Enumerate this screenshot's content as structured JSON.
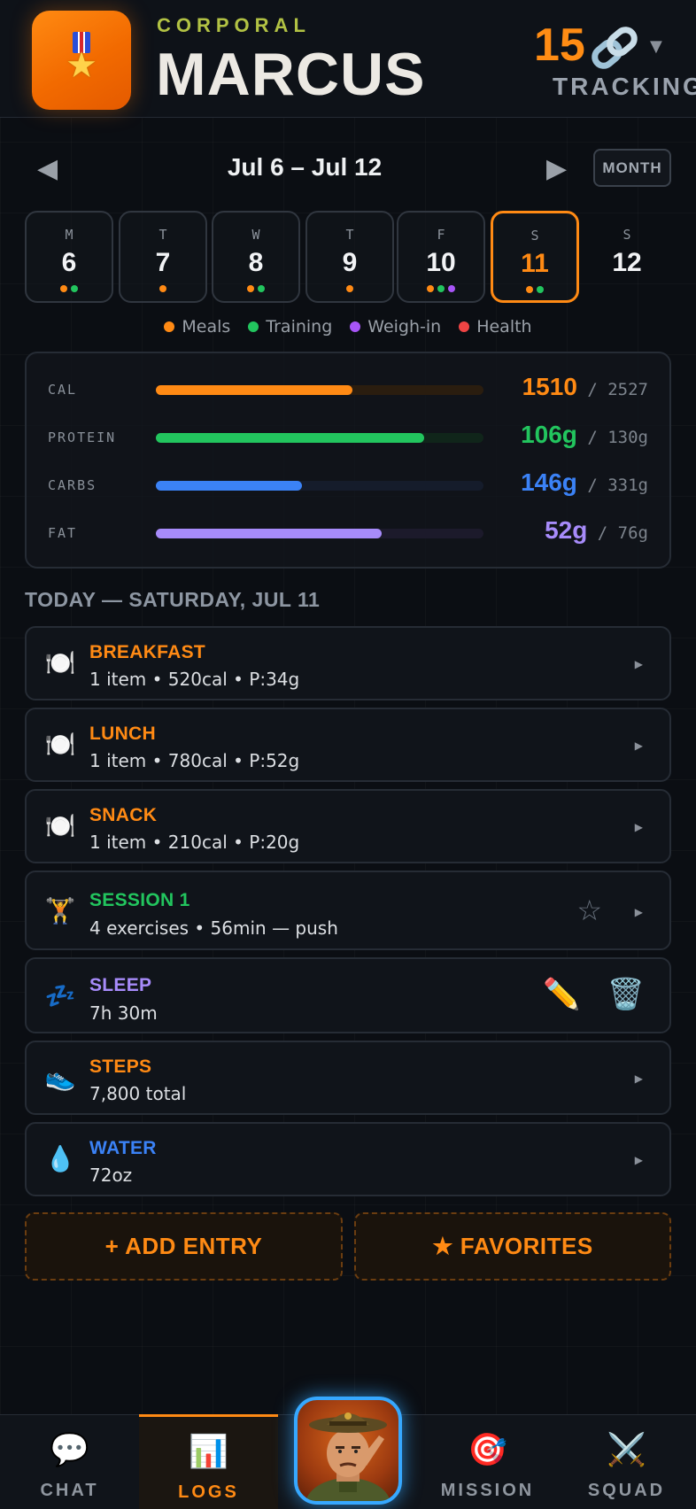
{
  "header": {
    "rank": "CORPORAL",
    "name": "MARCUS",
    "streak_count": "15",
    "tracking_label": "TRACKING"
  },
  "week": {
    "range": "Jul 6 – Jul 12",
    "month_label": "MONTH",
    "days": [
      {
        "letter": "M",
        "num": "6"
      },
      {
        "letter": "T",
        "num": "7"
      },
      {
        "letter": "W",
        "num": "8"
      },
      {
        "letter": "T",
        "num": "9"
      },
      {
        "letter": "F",
        "num": "10"
      },
      {
        "letter": "S",
        "num": "11"
      },
      {
        "letter": "S",
        "num": "12"
      }
    ],
    "selected_day": "11"
  },
  "legend": {
    "meals": "Meals",
    "training": "Training",
    "weighin": "Weigh-in",
    "health": "Health"
  },
  "colors": {
    "accent": "#ff8a14",
    "meals": "#ff8a14",
    "training": "#22c55e",
    "weighin": "#a855f7",
    "health": "#ef4444",
    "carbs": "#3b82f6",
    "fat": "#a78bfa"
  },
  "macros": {
    "cal": {
      "label": "CAL",
      "value": "1510",
      "target": "/ 2527",
      "progress": 0.6
    },
    "protein": {
      "label": "PROTEIN",
      "value": "106g",
      "target": "/ 130g",
      "progress": 0.82
    },
    "carbs": {
      "label": "CARBS",
      "value": "146g",
      "target": "/ 331g",
      "progress": 0.445
    },
    "fat": {
      "label": "FAT",
      "value": "52g",
      "target": "/ 76g",
      "progress": 0.69
    }
  },
  "today_heading": "TODAY — SATURDAY, JUL 11",
  "entries": {
    "breakfast": {
      "title": "BREAKFAST",
      "sub": "1 item • 520cal • P:34g"
    },
    "lunch": {
      "title": "LUNCH",
      "sub": "1 item • 780cal • P:52g"
    },
    "snack": {
      "title": "SNACK",
      "sub": "1 item • 210cal • P:20g"
    },
    "session": {
      "title": "SESSION 1",
      "sub": "4 exercises • 56min — push"
    },
    "sleep": {
      "title": "SLEEP",
      "sub": "7h 30m"
    },
    "steps": {
      "title": "STEPS",
      "sub": "7,800 total"
    },
    "water": {
      "title": "WATER",
      "sub": "72oz"
    }
  },
  "actions": {
    "add_entry": "+ ADD ENTRY",
    "favorites": "★ FAVORITES"
  },
  "nav": {
    "chat": "CHAT",
    "logs": "LOGS",
    "mission": "MISSION",
    "squad": "SQUAD"
  }
}
